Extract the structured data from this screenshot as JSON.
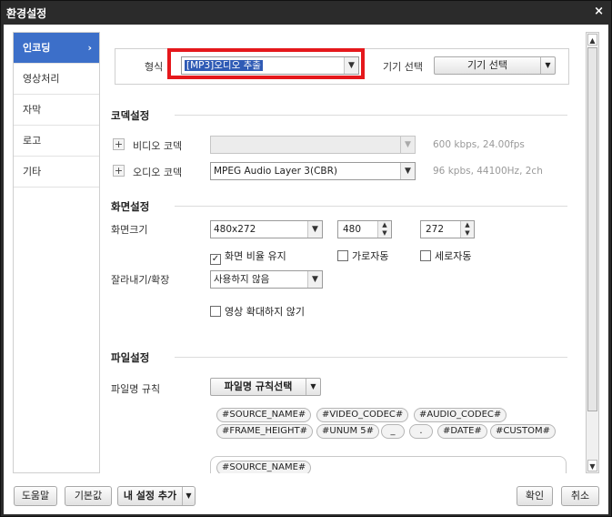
{
  "window": {
    "title": "환경설정",
    "close_glyph": "×"
  },
  "sidebar": {
    "items": [
      {
        "label": "인코딩",
        "active": true,
        "chevron": "›"
      },
      {
        "label": "영상처리"
      },
      {
        "label": "자막"
      },
      {
        "label": "로고"
      },
      {
        "label": "기타"
      }
    ]
  },
  "format": {
    "label": "형식",
    "value": "[MP3]오디오 추출",
    "device_label": "기기 선택",
    "device_button": "기기 선택"
  },
  "codec": {
    "title": "코덱설정",
    "video_label": "비디오 코덱",
    "video_value": "",
    "video_hint": "600 kbps, 24.00fps",
    "audio_label": "오디오 코덱",
    "audio_value": "MPEG Audio Layer 3(CBR)",
    "audio_hint": "96 kpbs, 44100Hz, 2ch"
  },
  "screen": {
    "title": "화면설정",
    "size_label": "화면크기",
    "size_value": "480x272",
    "width_value": "480",
    "height_value": "272",
    "keep_ratio_label": "화면 비율 유지",
    "keep_ratio_checked": true,
    "auto_w_label": "가로자동",
    "auto_h_label": "세로자동",
    "crop_label": "잘라내기/확장",
    "crop_value": "사용하지 않음",
    "no_upscale_label": "영상 확대하지 않기"
  },
  "file": {
    "title": "파일설정",
    "rule_label": "파일명 규칙",
    "rule_button": "파일명 규칙선택",
    "tags_row1": [
      "#SOURCE_NAME#",
      "#VIDEO_CODEC#",
      "#AUDIO_CODEC#"
    ],
    "tags_row2": [
      "#FRAME_HEIGHT#",
      "#UNUM 5#",
      "_",
      ".",
      "#DATE#",
      "#CUSTOM#"
    ],
    "current_tag": "#SOURCE_NAME#"
  },
  "footer": {
    "help": "도움말",
    "default": "기본값",
    "add_mine": "내 설정 추가",
    "ok": "확인",
    "cancel": "취소"
  },
  "colors": {
    "accent": "#3c6fc9",
    "highlight": "#e5181c",
    "title_bg": "#2b2b2b"
  }
}
